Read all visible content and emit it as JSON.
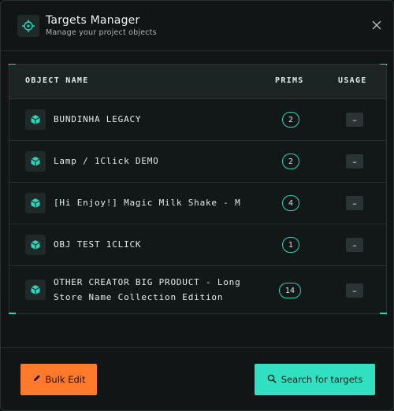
{
  "header": {
    "title": "Targets Manager",
    "subtitle": "Manage your project objects",
    "icon": "target-icon",
    "close_icon": "close-icon"
  },
  "table": {
    "columns": [
      "OBJECT NAME",
      "PRIMS",
      "USAGE"
    ],
    "rows": [
      {
        "name": "BUNDINHA LEGACY",
        "prims": "2",
        "usage": "–"
      },
      {
        "name": "Lamp / 1Click DEMO",
        "prims": "2",
        "usage": "–"
      },
      {
        "name": "[Hi Enjoy!] Magic Milk Shake - M",
        "prims": "4",
        "usage": "–"
      },
      {
        "name": "OBJ TEST 1CLICK",
        "prims": "1",
        "usage": "–"
      },
      {
        "name": "OTHER CREATOR BIG PRODUCT - Long Store Name Collection Edition",
        "prims": "14",
        "usage": "–"
      }
    ]
  },
  "footer": {
    "bulk_edit_label": "Bulk Edit",
    "search_label": "Search for targets"
  },
  "colors": {
    "accent_teal": "#31e0c0",
    "accent_orange": "#ff7a2a",
    "background": "#111515"
  }
}
